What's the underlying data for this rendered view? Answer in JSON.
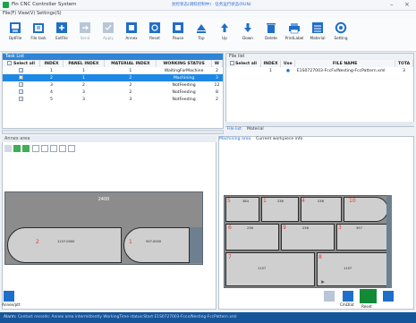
{
  "app": {
    "title": "Fin CNC Controller System",
    "status_center": "封控状态(调料控制中) · 任务运行状态(RUN)"
  },
  "window": {
    "minimize": "–",
    "close": "×"
  },
  "menu": [
    {
      "label": "File(F)"
    },
    {
      "label": "View(V)"
    },
    {
      "label": "Settings(S)"
    }
  ],
  "toolbar": [
    {
      "label": "OptFile",
      "icon": "optfile-icon"
    },
    {
      "label": "File task",
      "icon": "file-task-icon"
    },
    {
      "label": "ExtFile",
      "icon": "extfile-icon"
    },
    {
      "label": "Send",
      "icon": "send-icon",
      "disabled": true
    },
    {
      "label": "Apply",
      "icon": "apply-icon",
      "disabled": true
    },
    {
      "label": "Annex",
      "icon": "annex-icon"
    },
    {
      "label": "Reset",
      "icon": "reset-icon"
    },
    {
      "label": "Pause",
      "icon": "pause-icon"
    },
    {
      "label": "Top",
      "icon": "top-icon"
    },
    {
      "label": "Up",
      "icon": "up-icon"
    },
    {
      "label": "Down",
      "icon": "down-icon"
    },
    {
      "label": "Delete",
      "icon": "delete-icon"
    },
    {
      "label": "PrintLabel",
      "icon": "print-label-icon"
    },
    {
      "label": "Material",
      "icon": "material-icon"
    },
    {
      "label": "Setting",
      "icon": "setting-icon"
    }
  ],
  "task_list": {
    "title": "Task List",
    "columns": [
      "Select all",
      "INDEX",
      "PANEL INDEX",
      "MATERIAL INDEX",
      "WORKING STATUS",
      "W"
    ],
    "rows": [
      {
        "index": "1",
        "panel": "1",
        "material": "1",
        "status": "WaitingForMachine",
        "w": "2",
        "checked": true,
        "selected": false
      },
      {
        "index": "2",
        "panel": "1",
        "material": "2",
        "status": "Machining",
        "w": "3",
        "checked": true,
        "selected": true
      },
      {
        "index": "3",
        "panel": "2",
        "material": "2",
        "status": "NotFeeding",
        "w": "12",
        "checked": true,
        "selected": false
      },
      {
        "index": "4",
        "panel": "3",
        "material": "2",
        "status": "NotFeeding",
        "w": "8",
        "checked": true,
        "selected": false
      },
      {
        "index": "5",
        "panel": "3",
        "material": "3",
        "status": "NotFeeding",
        "w": "2",
        "checked": true,
        "selected": false
      }
    ]
  },
  "file_list": {
    "title": "File list",
    "columns": [
      "Select all",
      "INDEX",
      "Use",
      "FILE NAME",
      "TOTA"
    ],
    "rows": [
      {
        "index": "1",
        "use": "●",
        "file_name": "E1S0727003-FccFx/Nesting-FccPattern.xml",
        "total": "3"
      }
    ],
    "tabs": [
      "File list",
      "Material"
    ]
  },
  "annex_area": {
    "title": "Annex area",
    "sheet_label": "2400",
    "part_labels": [
      "1157.0000",
      "597.0000"
    ],
    "part_numbers": [
      "2",
      "1"
    ]
  },
  "machining_area": {
    "tabs": [
      "Machining area",
      "Current workpiece info"
    ],
    "part_numbers": [
      "5",
      "1",
      "4",
      "6",
      "9",
      "7",
      "8",
      "3",
      "10"
    ],
    "part_texts": [
      "364",
      "236",
      "236",
      "236",
      "236",
      "397",
      "1157",
      "1157"
    ]
  },
  "bottom_tools": [
    {
      "label": "Annex/ptt",
      "icon": "annex-ptt-icon"
    },
    {
      "label": "CmDlat",
      "icon": "cmdlat-icon"
    },
    {
      "label": "Reset",
      "icon": "reset-green-icon"
    }
  ],
  "statusbar": {
    "label": "Alarm:",
    "message": "Contact records: Annex area intermittently WorkingTime status:Start E1S0727003-Fccx/Nesting-FccPattern.xml"
  }
}
